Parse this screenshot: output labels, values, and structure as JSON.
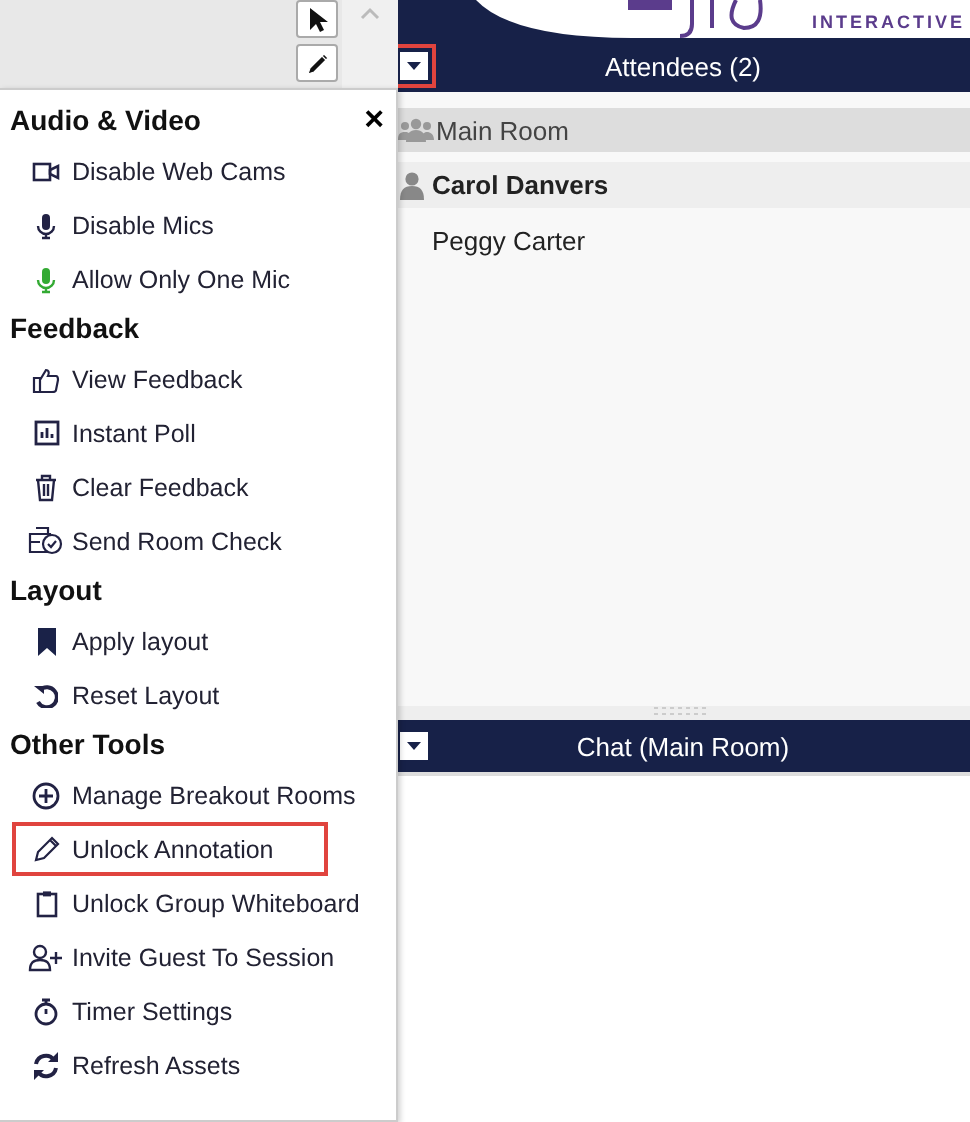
{
  "toolbar": {
    "tools": [
      {
        "kind": "pointer",
        "selected": false
      },
      {
        "kind": "pencil",
        "selected": false
      }
    ]
  },
  "menu": {
    "close": "×",
    "sections": [
      {
        "title": "Audio & Video",
        "items": [
          {
            "kind": "camera",
            "label": "Disable Web Cams",
            "highlighted": false
          },
          {
            "kind": "mic",
            "label": "Disable Mics",
            "highlighted": false
          },
          {
            "kind": "micgreen",
            "label": "Allow Only One Mic",
            "highlighted": false
          }
        ]
      },
      {
        "title": "Feedback",
        "items": [
          {
            "kind": "thumb",
            "label": "View Feedback",
            "highlighted": false
          },
          {
            "kind": "poll",
            "label": "Instant Poll",
            "highlighted": false
          },
          {
            "kind": "trash",
            "label": "Clear Feedback",
            "highlighted": false
          },
          {
            "kind": "roomcheck",
            "label": "Send Room Check",
            "highlighted": false
          }
        ]
      },
      {
        "title": "Layout",
        "items": [
          {
            "kind": "bookmark",
            "label": "Apply layout",
            "highlighted": false
          },
          {
            "kind": "undo",
            "label": "Reset Layout",
            "highlighted": false
          }
        ]
      },
      {
        "title": "Other Tools",
        "items": [
          {
            "kind": "add",
            "label": "Manage Breakout Rooms",
            "highlighted": false
          },
          {
            "kind": "pencil",
            "label": "Unlock Annotation",
            "highlighted": true
          },
          {
            "kind": "clipboard",
            "label": "Unlock Group Whiteboard",
            "highlighted": false
          },
          {
            "kind": "invite",
            "label": "Invite Guest To Session",
            "highlighted": false
          },
          {
            "kind": "stopwatch",
            "label": "Timer Settings",
            "highlighted": false
          },
          {
            "kind": "refresh",
            "label": "Refresh Assets",
            "highlighted": false
          }
        ]
      }
    ]
  },
  "logo": {
    "subtitle": "INTERACTIVE"
  },
  "attendees": {
    "title": "Attendees (2)",
    "dropdown_highlighted": true,
    "room": "Main Room",
    "people": [
      {
        "name": "Carol Danvers",
        "host": true
      },
      {
        "name": "Peggy Carter",
        "host": false
      }
    ]
  },
  "chat": {
    "title": "Chat (Main Room)",
    "dropdown_highlighted": false
  }
}
